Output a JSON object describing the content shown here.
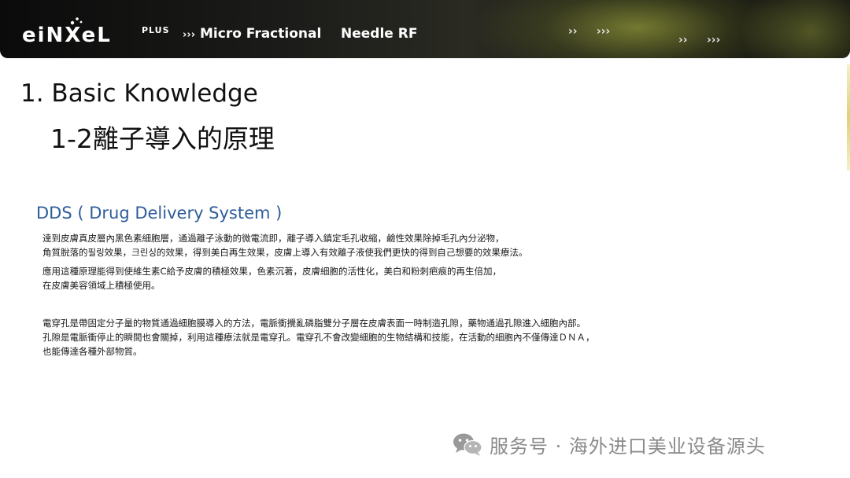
{
  "header": {
    "brand_wordmark": "eiNXeL",
    "brand_plus": "PLUS",
    "nav_chevrons": "›››",
    "nav_items": [
      {
        "label": "Micro Fractional"
      },
      {
        "label": "Needle RF"
      }
    ],
    "deco_chevrons": [
      "››",
      "›››",
      "››",
      "›››"
    ],
    "colors": {
      "band": "#111111",
      "glow": "#bec846",
      "text": "#ffffff"
    }
  },
  "slide": {
    "title": "1. Basic Knowledge",
    "subtitle": "1-2離子導入的原理",
    "section_heading": "DDS ( Drug Delivery System )",
    "heading_color": "#2e5d9a",
    "paragraphs": [
      {
        "lines": [
          "達到皮膚真皮層內黑色素細胞層，通過離子泳動的微電流即，離子導入鎮定毛孔收縮，鹼性效果除掉毛孔內分泌物，",
          "角質脫落的필링效果，크린싱的效果，得到美白再生效果，皮膚上導入有效離子液使我們更快的得到自己想要的效果療法。"
        ]
      },
      {
        "lines": [
          "應用這種原理能得到使維生素C給予皮膚的積極效果，色素沉著，皮膚細胞的活性化，美白和粉刺疤痕的再生倍加，",
          "在皮膚美容領域上積極使用。"
        ]
      },
      {
        "lines": [
          "電穿孔是帶固定分子量的物質通過細胞膜導入的方法，電脈衝攪亂磷脂雙分子層在皮膚表面一時制造孔隙，藥物通過孔隙進入細胞內部。",
          "孔隙是電脈衝停止的瞬間也會關掉，利用這種療法就是電穿孔。電穿孔不會改變細胞的生物結構和技能，在活動的細胞內不僅傳達ＤＮＡ，",
          "也能傳達各種外部物質。"
        ]
      }
    ]
  },
  "watermark": {
    "icon": "wechat-icon",
    "text": "服务号 · 海外进口美业设备源头",
    "color": "#8a8a8a"
  }
}
